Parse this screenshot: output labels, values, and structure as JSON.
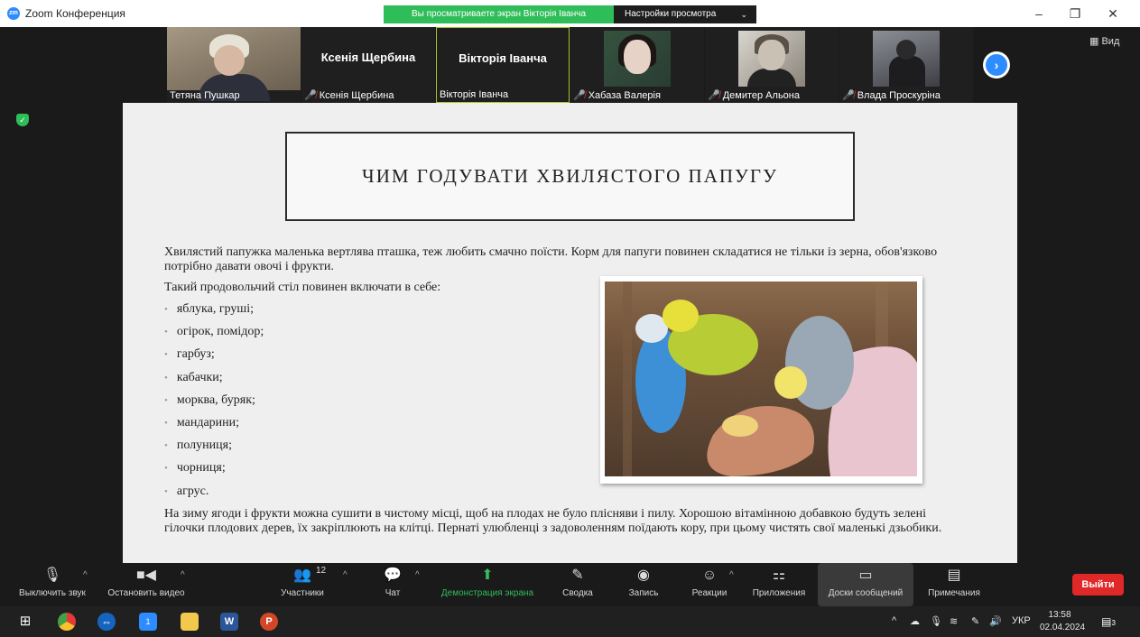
{
  "window": {
    "title": "Zoom Конференция",
    "logo_text": "zm",
    "share_banner": "Вы просматриваете экран Вікторія Іванча",
    "view_settings": "Настройки просмотра",
    "controls": {
      "minimize": "–",
      "maximize": "❐",
      "close": "✕"
    }
  },
  "participants": [
    {
      "label": "Тетяна Пушкар",
      "muted": false
    },
    {
      "name": "Ксенія Щербина",
      "label": "Ксенія Щербина",
      "muted": true
    },
    {
      "name": "Вікторія Іванча",
      "label": "Вікторія Іванча",
      "muted": false,
      "active": true
    },
    {
      "label": "Хабаза Валерія",
      "muted": true
    },
    {
      "label": "Демитер Альона",
      "muted": true
    },
    {
      "label": "Влада Проскуріна",
      "muted": true
    }
  ],
  "view_button": "Вид",
  "document": {
    "title": "ЧИМ ГОДУВАТИ ХВИЛЯСТОГО ПАПУГУ",
    "intro": "Хвилястий папужка маленька вертлява пташка, теж любить смачно поїсти. Корм для папуги повинен складатися не тільки із зерна, обов'язково потрібно давати овочі і фрукти.",
    "list_intro": "Такий продовольчий стіл повинен включати в себе:",
    "items": [
      "яблука, груші;",
      "огірок, помідор;",
      "гарбуз;",
      "кабачки;",
      "морква, буряк;",
      "мандарини;",
      "полуниця;",
      "чорниця;",
      "агрус."
    ],
    "outro": "На зиму ягоди і фрукти можна сушити в чистому місці, щоб на плодах не було плісняви і пилу. Хорошою вітамінною добавкою будуть зелені гілочки плодових дерев, їх закріплюють на клітці. Пернаті улюбленці з задоволенням поїдають кору, при цьому чистять свої маленькі дзьобики."
  },
  "toolbar": {
    "mute": "Выключить звук",
    "video": "Остановить видео",
    "participants": "Участники",
    "participants_count": "12",
    "chat": "Чат",
    "share": "Демонстрация экрана",
    "summary": "Сводка",
    "record": "Запись",
    "reactions": "Реакции",
    "apps": "Приложения",
    "whiteboards": "Доски сообщений",
    "notes": "Примечания",
    "leave": "Выйти"
  },
  "taskbar": {
    "language": "УКР",
    "time": "13:58",
    "date": "02.04.2024",
    "zoom_badge": "1",
    "notif_badge": "3"
  }
}
